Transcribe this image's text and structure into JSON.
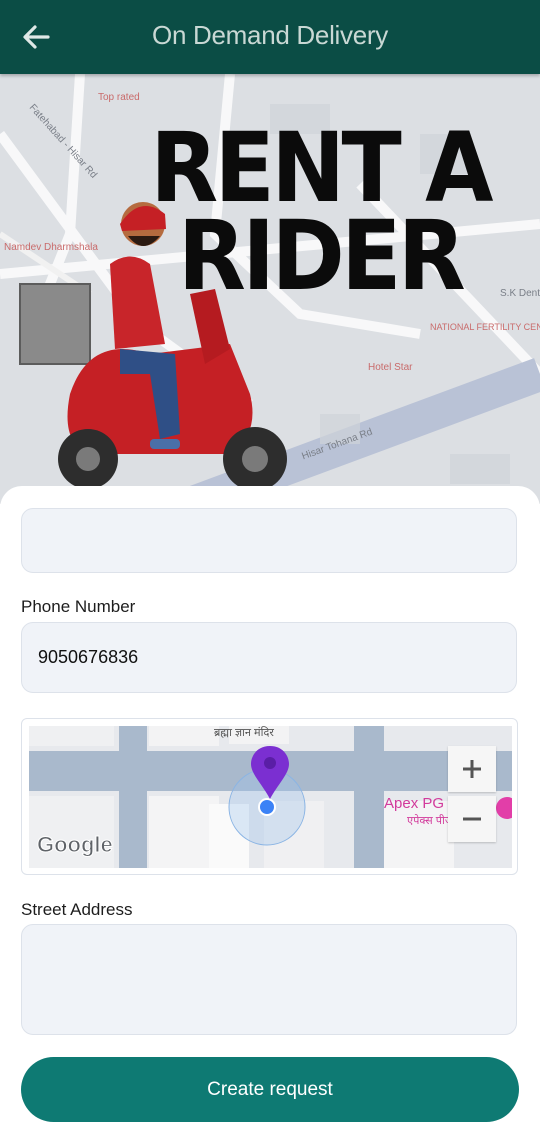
{
  "header": {
    "title": "On Demand Delivery",
    "back_icon": "arrow-left-icon"
  },
  "hero": {
    "headline_line1": "RENT A",
    "headline_line2": "RIDER",
    "map_labels": [
      "Fatehabad - Hisar Rd",
      "Namdev Dharmshala",
      "NATIONAL FERTILITY CENTRE - Best IVF",
      "Hotel Star",
      "Hisar Tohana Rd",
      "S.K Dental",
      "Top rated"
    ]
  },
  "form": {
    "phone_label": "Phone Number",
    "phone_value": "9050676836",
    "street_label": "Street Address",
    "street_value": "",
    "submit_label": "Create request"
  },
  "map": {
    "place_top": "ब्रह्मा ज्ञान मंदिर",
    "place_name": "Apex PG Hisar",
    "place_name_hi": "एपेक्स पीजी",
    "google_logo": "Google",
    "zoom_in_icon": "plus-icon",
    "zoom_out_icon": "minus-icon"
  },
  "colors": {
    "header": "#0b4d45",
    "button": "#0e7a73",
    "pin": "#7b2fd1",
    "location_dot": "#3b82f6"
  }
}
